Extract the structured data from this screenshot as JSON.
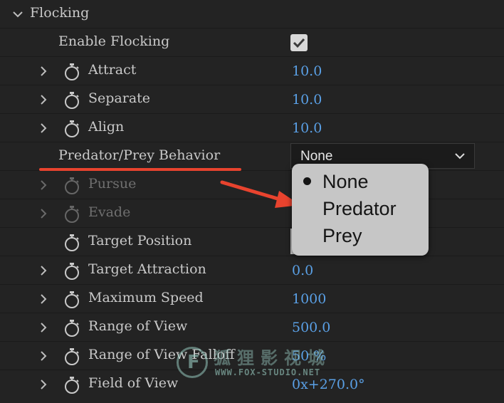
{
  "section": {
    "title": "Flocking"
  },
  "rows": {
    "enable_flocking": {
      "label": "Enable Flocking",
      "checked": true
    },
    "attract": {
      "label": "Attract",
      "value": "10.0"
    },
    "separate": {
      "label": "Separate",
      "value": "10.0"
    },
    "align": {
      "label": "Align",
      "value": "10.0"
    },
    "predator_prey": {
      "label": "Predator/Prey Behavior",
      "selected": "None"
    },
    "pursue": {
      "label": "Pursue"
    },
    "evade": {
      "label": "Evade"
    },
    "target_position": {
      "label": "Target Position"
    },
    "target_attraction": {
      "label": "Target Attraction",
      "value": "0.0"
    },
    "maximum_speed": {
      "label": "Maximum Speed",
      "value": "1000"
    },
    "range_of_view": {
      "label": "Range of View",
      "value": "500.0"
    },
    "range_of_view_falloff": {
      "label": "Range of View Falloff",
      "value": "50 %"
    },
    "field_of_view": {
      "label": "Field of View",
      "value": "0x+270.0°"
    }
  },
  "popup": {
    "options": [
      "None",
      "Predator",
      "Prey"
    ],
    "selected": "None"
  },
  "watermark": {
    "logo": "F",
    "cn": "狐狸影视城",
    "url": "WWW.FOX-STUDIO.NET"
  },
  "colors": {
    "background": "#232323",
    "value_blue": "#5aa0e6",
    "annotation_red": "#e8432e"
  },
  "icons": [
    "chevron-down-icon",
    "chevron-right-icon",
    "stopwatch-icon",
    "checkmark-icon",
    "bullet-icon",
    "arrow-icon"
  ]
}
